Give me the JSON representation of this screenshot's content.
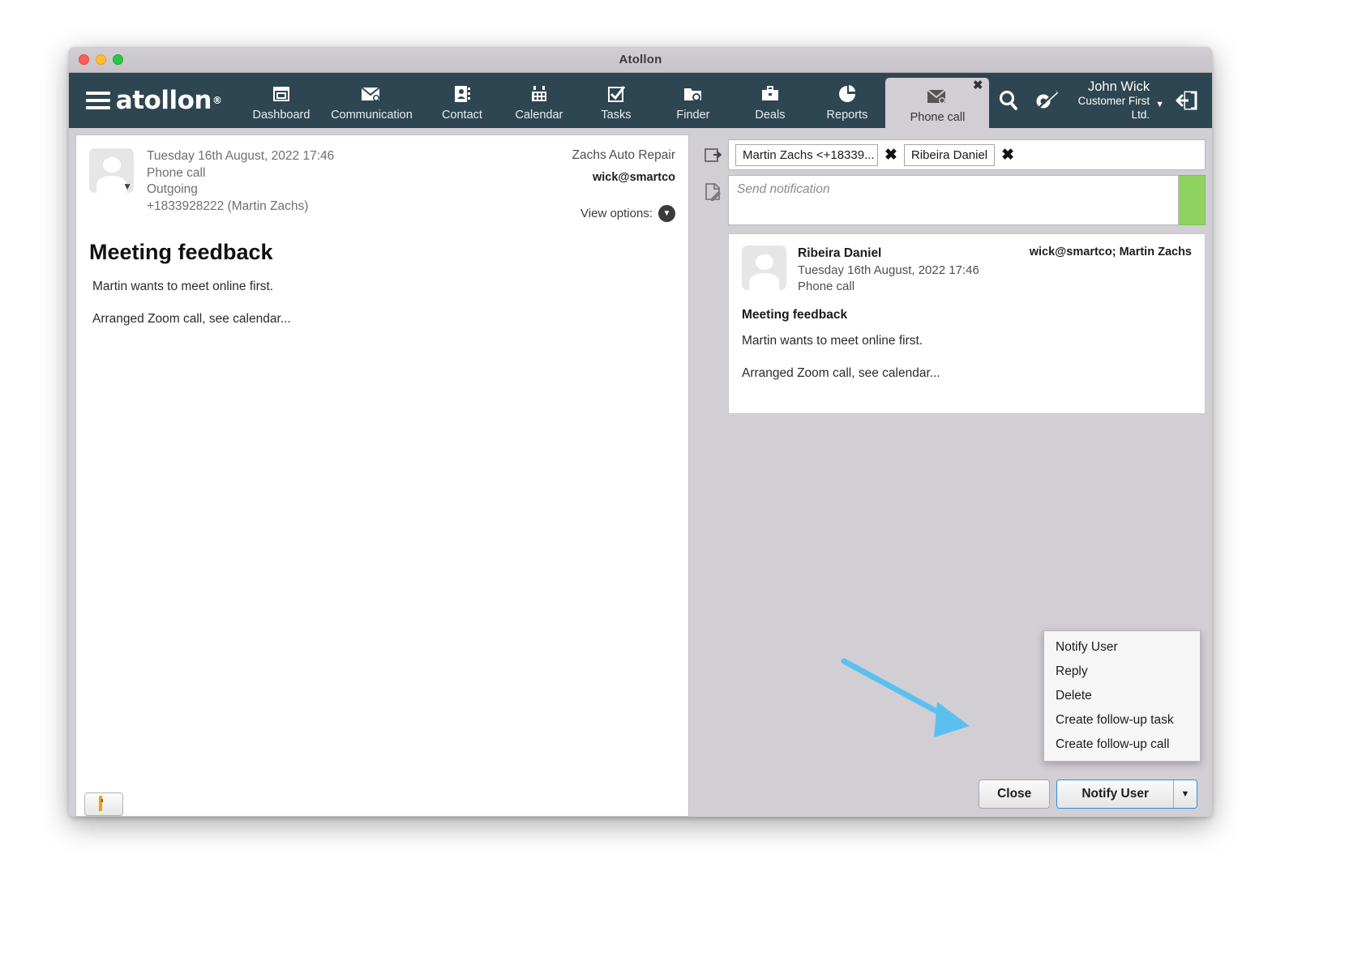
{
  "window": {
    "title": "Atollon",
    "traffic_lights": [
      "close",
      "minimize",
      "maximize"
    ]
  },
  "nav": {
    "brand": "atollon",
    "brand_mark": "®",
    "items": [
      {
        "label": "Dashboard",
        "icon": "dashboard-icon",
        "active": false
      },
      {
        "label": "Communication",
        "icon": "envelope-icon",
        "active": false
      },
      {
        "label": "Contact",
        "icon": "address-book-icon",
        "active": false
      },
      {
        "label": "Calendar",
        "icon": "calendar-icon",
        "active": false
      },
      {
        "label": "Tasks",
        "icon": "checkbox-icon",
        "active": false
      },
      {
        "label": "Finder",
        "icon": "folder-search-icon",
        "active": false
      },
      {
        "label": "Deals",
        "icon": "briefcase-icon",
        "active": false
      },
      {
        "label": "Reports",
        "icon": "pie-chart-icon",
        "active": false
      },
      {
        "label": "Phone call",
        "icon": "envelope-icon",
        "active": true
      }
    ],
    "search_icon": "search-icon",
    "settings_icon": "wrench-icon",
    "logout_icon": "logout-icon",
    "user": {
      "name": "John Wick",
      "company": "Customer First Ltd.",
      "caret": "▼"
    }
  },
  "message": {
    "datetime": "Tuesday 16th August, 2022 17:46",
    "type": "Phone call",
    "direction": "Outgoing",
    "phone": "+1833928222 (Martin Zachs)",
    "organization": "Zachs Auto Repair",
    "account": "wick@smartco",
    "view_options_label": "View options:",
    "subject": "Meeting feedback",
    "paragraphs": [
      "Martin wants to meet online first.",
      "Arranged Zoom call, see calendar..."
    ]
  },
  "notify": {
    "recipients": [
      {
        "label": "Martin Zachs <+18339..."
      },
      {
        "label": "Ribeira  Daniel"
      }
    ],
    "remove_glyph": "✖",
    "note_placeholder": "Send notification",
    "send_button_color": "#8ed35f",
    "forward_icon": "forward-icon",
    "note-icon": "note-edit-icon"
  },
  "thread": {
    "author": "Ribeira  Daniel",
    "datetime": "Tuesday 16th August, 2022 17:46",
    "type": "Phone call",
    "recipients_line": "wick@smartco; Martin Zachs",
    "subject": "Meeting feedback",
    "paragraphs": [
      "Martin wants to meet online first.",
      "Arranged Zoom call, see calendar..."
    ]
  },
  "dropdown": {
    "items": [
      {
        "label": "Notify User"
      },
      {
        "label": "Reply"
      },
      {
        "label": "Delete"
      },
      {
        "label": "Create follow-up task"
      },
      {
        "label": "Create follow-up call"
      }
    ]
  },
  "footer": {
    "lock_icon": "lock-icon",
    "close_label": "Close",
    "primary_label": "Notify User",
    "primary_caret": "▼",
    "accent_color": "#2e8fe0"
  },
  "annotation": {
    "arrow_color": "#5bc0f0"
  }
}
